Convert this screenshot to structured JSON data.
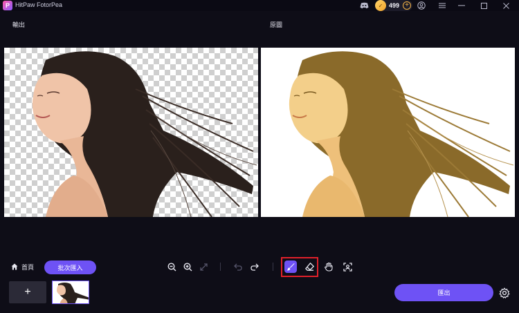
{
  "app": {
    "title": "HitPaw FotorPea",
    "logo_letter": "P"
  },
  "titlebar": {
    "coins": "499"
  },
  "panels": {
    "output_label": "輸出",
    "original_label": "原圖"
  },
  "toolbar": {
    "home_label": "首頁",
    "batch_import_label": "批次匯入"
  },
  "footer": {
    "add_symbol": "+",
    "export_label": "匯出"
  },
  "colors": {
    "accent": "#6e52f5",
    "highlight": "#e2202a",
    "background": "#0e0d17"
  },
  "icons": [
    "discord-icon",
    "coin-icon",
    "plus-circle-icon",
    "account-icon",
    "menu-icon",
    "minimize-icon",
    "maximize-icon",
    "close-icon",
    "home-icon",
    "zoom-out-icon",
    "zoom-in-icon",
    "fit-icon",
    "undo-icon",
    "redo-icon",
    "brush-icon",
    "eraser-icon",
    "hand-icon",
    "view-icon",
    "gear-icon"
  ]
}
